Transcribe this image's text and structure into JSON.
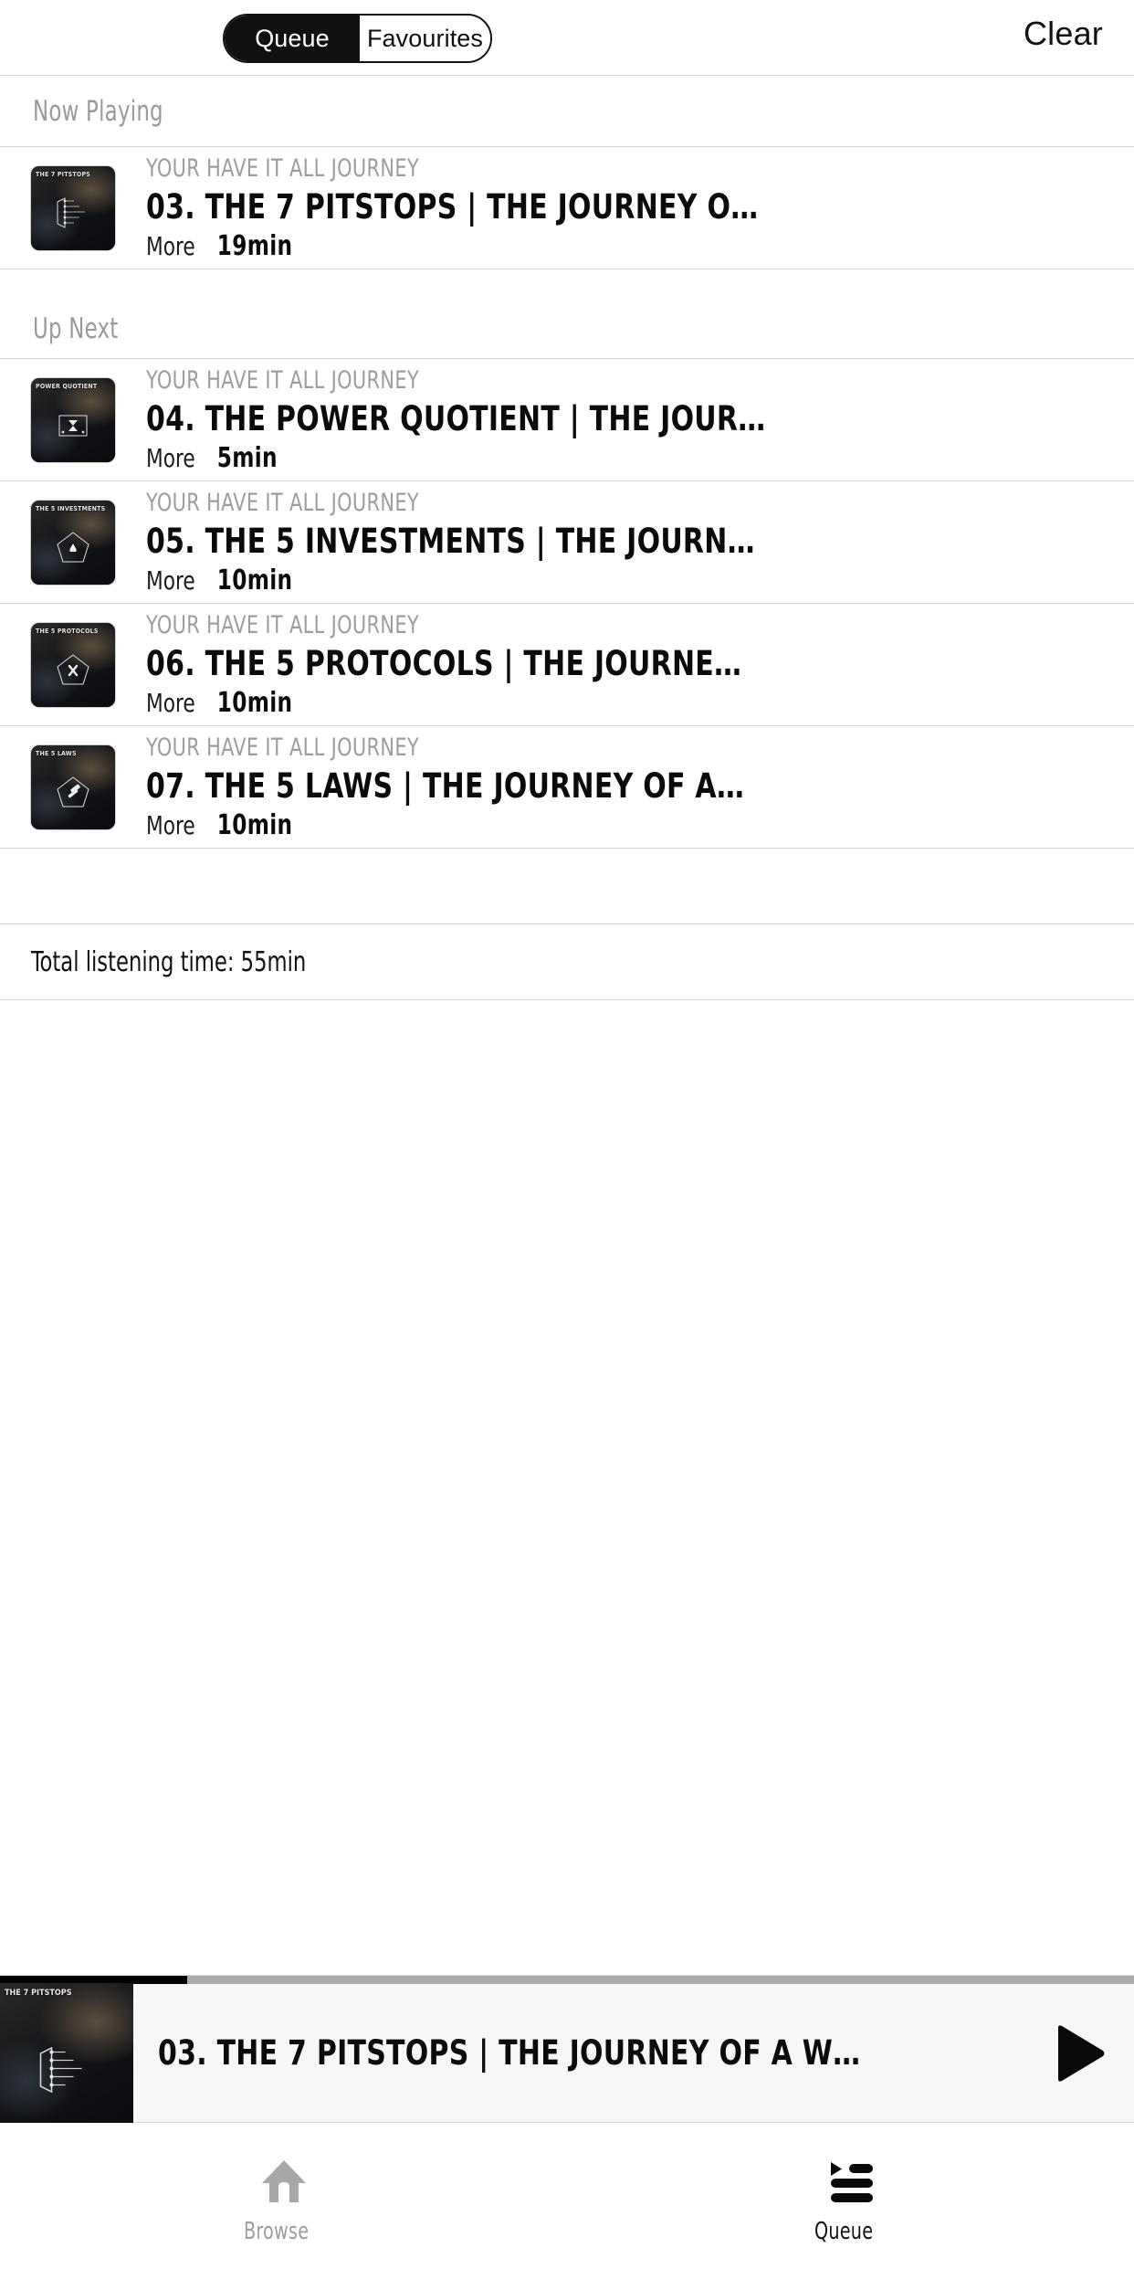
{
  "header": {
    "segments": [
      {
        "label": "Queue",
        "active": true
      },
      {
        "label": "Favourites",
        "active": false
      }
    ],
    "clear_label": "Clear"
  },
  "sections": {
    "now_playing_label": "Now Playing",
    "up_next_label": "Up Next"
  },
  "now_playing": {
    "album": "YOUR HAVE IT ALL JOURNEY",
    "title": "03. THE 7 PITSTOPS | THE JOURNEY O…",
    "more_label": "More",
    "duration": "19min",
    "artwork_caption": "THE 7 PITSTOPS"
  },
  "up_next": [
    {
      "album": "YOUR HAVE IT ALL JOURNEY",
      "title": "04. THE POWER QUOTIENT | THE JOUR…",
      "more_label": "More",
      "duration": "5min",
      "artwork_caption": "POWER QUOTIENT"
    },
    {
      "album": "YOUR HAVE IT ALL JOURNEY",
      "title": "05. THE 5 INVESTMENTS | THE JOURN…",
      "more_label": "More",
      "duration": "10min",
      "artwork_caption": "THE 5 INVESTMENTS"
    },
    {
      "album": "YOUR HAVE IT ALL JOURNEY",
      "title": "06. THE 5 PROTOCOLS | THE JOURNE…",
      "more_label": "More",
      "duration": "10min",
      "artwork_caption": "THE 5 PROTOCOLS"
    },
    {
      "album": "YOUR HAVE IT ALL JOURNEY",
      "title": "07. THE 5 LAWS | THE JOURNEY OF A…",
      "more_label": "More",
      "duration": "10min",
      "artwork_caption": "THE 5 LAWS"
    }
  ],
  "footer": {
    "total_label": "Total listening time: 55min"
  },
  "mini_player": {
    "title": "03. THE 7 PITSTOPS | THE JOURNEY OF A W…",
    "artwork_caption": "THE 7 PITSTOPS",
    "progress_percent": 16.5,
    "play_icon": "play-icon"
  },
  "bottom_nav": [
    {
      "label": "Browse",
      "icon": "home-icon",
      "active": false
    },
    {
      "label": "Queue",
      "icon": "playlist-icon",
      "active": true
    }
  ],
  "colors": {
    "accent": "#000000",
    "muted_text": "#9d9d9d",
    "divider": "#d6d6d6",
    "player_bg": "#f7f7f7",
    "progress_track": "#ababab"
  }
}
